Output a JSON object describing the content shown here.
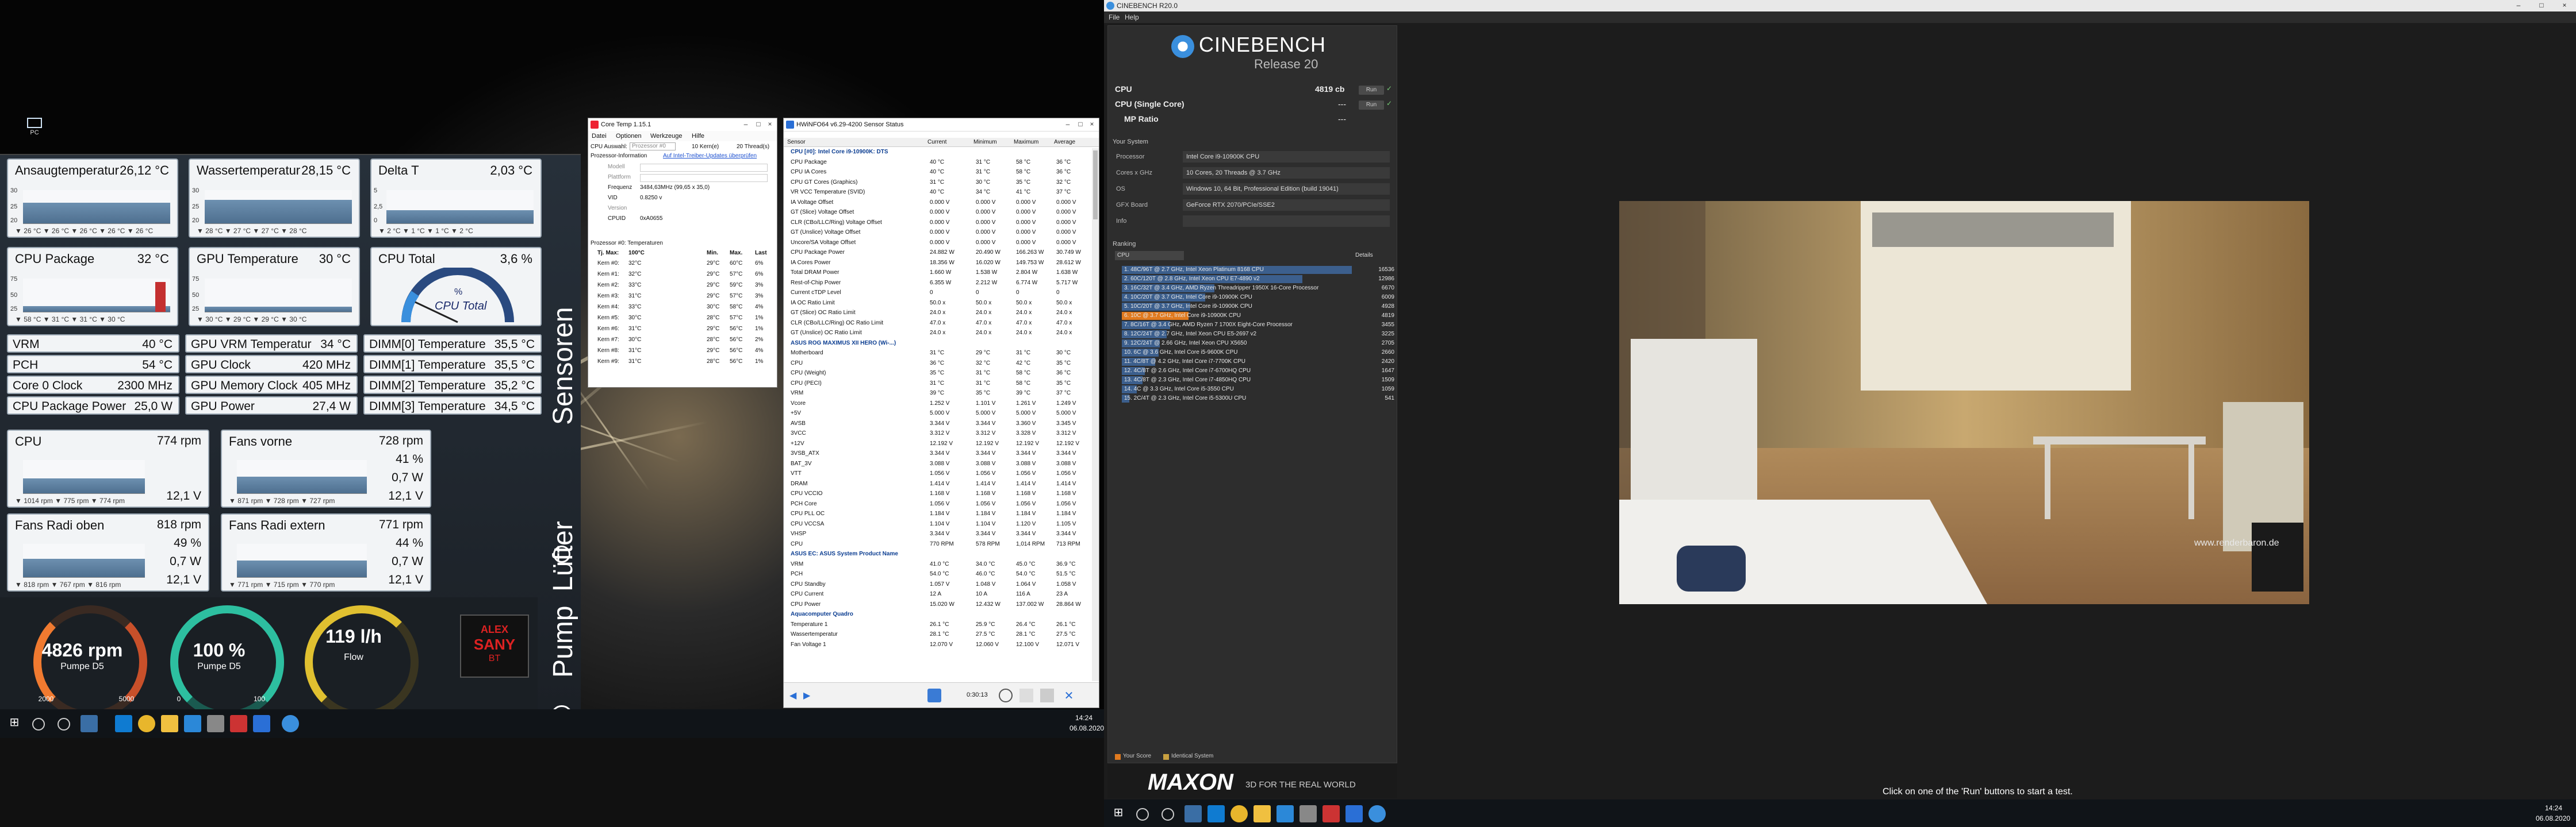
{
  "left": {
    "desktop": {
      "pc_icon_label": "PC"
    },
    "panel": {
      "temp_tiles": [
        {
          "label": "Ansaugtemperatur",
          "value": "26,12 °C",
          "ymax": "30",
          "ymid": "25",
          "ymin": "20",
          "ticks": "▼ 26 °C  ▼ 26 °C  ▼ 26 °C  ▼ 26 °C  ▼ 26 °C"
        },
        {
          "label": "Wassertemperatur",
          "value": "28,15 °C",
          "ymax": "30",
          "ymid": "25",
          "ymin": "20",
          "ticks": "▼ 28 °C  ▼ 27 °C  ▼ 27 °C  ▼ 28 °C"
        },
        {
          "label": "Delta T",
          "value": "2,03 °C",
          "ymax": "5",
          "ymid": "2,5",
          "ymin": "0",
          "ticks": "▼ 2 °C  ▼ 1 °C  ▼ 1 °C  ▼ 2 °C"
        },
        {
          "label": "CPU Package",
          "value": "32 °C",
          "ymax": "75",
          "ymid": "50",
          "ymin": "25",
          "ticks": "▼ 58 °C  ▼ 31 °C  ▼ 31 °C  ▼ 30 °C"
        },
        {
          "label": "GPU Temperature",
          "value": "30 °C",
          "ymax": "75",
          "ymid": "50",
          "ymin": "25",
          "ticks": "▼ 30 °C  ▼ 29 °C  ▼ 29 °C  ▼ 30 °C"
        }
      ],
      "cpu_total": {
        "label": "CPU Total",
        "value": "3,6 %",
        "gauge_label": "CPU Total",
        "gauge_unit": "%"
      },
      "rows": [
        [
          {
            "label": "VRM",
            "value": "40 °C"
          },
          {
            "label": "GPU VRM Temperatur",
            "value": "34 °C"
          },
          {
            "label": "DIMM[0] Temperature",
            "value": "35,5 °C"
          }
        ],
        [
          {
            "label": "PCH",
            "value": "54 °C"
          },
          {
            "label": "GPU Clock",
            "value": "420 MHz"
          },
          {
            "label": "DIMM[1] Temperature",
            "value": "35,5 °C"
          }
        ],
        [
          {
            "label": "Core 0 Clock",
            "value": "2300 MHz"
          },
          {
            "label": "GPU Memory Clock",
            "value": "405 MHz"
          },
          {
            "label": "DIMM[2] Temperature",
            "value": "35,2 °C"
          }
        ],
        [
          {
            "label": "CPU Package Power",
            "value": "25,0 W"
          },
          {
            "label": "GPU Power",
            "value": "27,4 W"
          },
          {
            "label": "DIMM[3] Temperature",
            "value": "34,5 °C"
          }
        ]
      ],
      "fan_tiles": [
        {
          "label": "CPU",
          "rpm": "774 rpm",
          "pct": "",
          "volt": "12,1 V",
          "ticks": "▼ 1014 rpm  ▼ 775 rpm  ▼ 774 rpm"
        },
        {
          "label": "Fans vorne",
          "rpm": "728 rpm",
          "pct": "41 %",
          "volt": "0,7 W",
          "volt2": "12,1 V",
          "ticks": "▼ 871 rpm  ▼ 728 rpm  ▼ 727 rpm"
        },
        {
          "label": "Fans Radi oben",
          "rpm": "818 rpm",
          "pct": "49 %",
          "volt": "0,7 W",
          "volt2": "12,1 V",
          "ticks": "▼ 818 rpm  ▼ 767 rpm  ▼ 816 rpm"
        },
        {
          "label": "Fans Radi extern",
          "rpm": "771 rpm",
          "pct": "44 %",
          "volt": "0,7 W",
          "volt2": "12,1 V",
          "ticks": "▼ 771 rpm  ▼ 715 rpm  ▼ 770 rpm"
        }
      ],
      "pump": {
        "rpm_value": "4826 rpm",
        "rpm_label": "Pumpe D5",
        "rpm_min": "2000",
        "rpm_max": "5000",
        "pct_value": "100 %",
        "pct_label": "Pumpe D5",
        "pct_min": "0",
        "pct_max": "100",
        "flow_value": "119 l/h",
        "flow_label": "Flow",
        "logo_line1": "ALEX",
        "logo_line2": "SANY",
        "logo_line3": "BT"
      },
      "side_labels": {
        "sensoren": "Sensoren",
        "luefter": "Lüfter",
        "pump": "Pump"
      }
    },
    "coretemp": {
      "title": "Core Temp 1.15.1",
      "menu": [
        "Datei",
        "Optionen",
        "Werkzeuge",
        "Hilfe"
      ],
      "cpu_select_label": "CPU Auswahl:",
      "cpu_select_value": "Prozessor #0",
      "cores_label": "10 Kern(e)",
      "threads_label": "20 Thread(s)",
      "proc_info_label": "Prozessor-Information",
      "update_link": "Auf Intel-Treiber-Updates überprüfen",
      "fields": [
        {
          "label": "Modell",
          "value": ""
        },
        {
          "label": "Plattform",
          "value": ""
        },
        {
          "label": "Frequenz",
          "value": "3484,63MHz (99,65 x 35,0)"
        },
        {
          "label": "VID",
          "value": "0.8250 v"
        },
        {
          "label": "Version",
          "value": ""
        },
        {
          "label": "CPUID",
          "value": "0xA0655"
        }
      ],
      "temps_title": "Prozessor #0: Temperaturen",
      "temp_headers": [
        "Tj. Max:",
        "100°C",
        "Min.",
        "Max.",
        "Last"
      ],
      "cores": [
        [
          "Kern #0:",
          "32°C",
          "29°C",
          "60°C",
          "6%"
        ],
        [
          "Kern #1:",
          "32°C",
          "29°C",
          "57°C",
          "6%"
        ],
        [
          "Kern #2:",
          "33°C",
          "29°C",
          "59°C",
          "3%"
        ],
        [
          "Kern #3:",
          "31°C",
          "29°C",
          "57°C",
          "3%"
        ],
        [
          "Kern #4:",
          "33°C",
          "30°C",
          "58°C",
          "4%"
        ],
        [
          "Kern #5:",
          "30°C",
          "28°C",
          "57°C",
          "1%"
        ],
        [
          "Kern #6:",
          "31°C",
          "29°C",
          "56°C",
          "1%"
        ],
        [
          "Kern #7:",
          "30°C",
          "28°C",
          "56°C",
          "2%"
        ],
        [
          "Kern #8:",
          "31°C",
          "29°C",
          "56°C",
          "4%"
        ],
        [
          "Kern #9:",
          "31°C",
          "28°C",
          "56°C",
          "1%"
        ]
      ]
    },
    "hwinfo": {
      "title": "HWiNFO64 v6.29-4200 Sensor Status",
      "headers": [
        "Sensor",
        "Current",
        "Minimum",
        "Maximum",
        "Average"
      ],
      "rows": [
        {
          "g": true,
          "name": "CPU [#0]: Intel Core i9-10900K: DTS"
        },
        {
          "name": "CPU Package",
          "c": "40 °C",
          "mn": "31 °C",
          "mx": "58 °C",
          "av": "36 °C"
        },
        {
          "name": "CPU IA Cores",
          "c": "40 °C",
          "mn": "31 °C",
          "mx": "58 °C",
          "av": "36 °C"
        },
        {
          "name": "CPU GT Cores (Graphics)",
          "c": "31 °C",
          "mn": "30 °C",
          "mx": "35 °C",
          "av": "32 °C"
        },
        {
          "name": "VR VCC Temperature (SVID)",
          "c": "40 °C",
          "mn": "34 °C",
          "mx": "41 °C",
          "av": "37 °C"
        },
        {
          "name": "IA Voltage Offset",
          "c": "0.000 V",
          "mn": "0.000 V",
          "mx": "0.000 V",
          "av": "0.000 V"
        },
        {
          "name": "GT (Slice) Voltage Offset",
          "c": "0.000 V",
          "mn": "0.000 V",
          "mx": "0.000 V",
          "av": "0.000 V"
        },
        {
          "name": "CLR (CBo/LLC/Ring) Voltage Offset",
          "c": "0.000 V",
          "mn": "0.000 V",
          "mx": "0.000 V",
          "av": "0.000 V"
        },
        {
          "name": "GT (Unslice) Voltage Offset",
          "c": "0.000 V",
          "mn": "0.000 V",
          "mx": "0.000 V",
          "av": "0.000 V"
        },
        {
          "name": "Uncore/SA Voltage Offset",
          "c": "0.000 V",
          "mn": "0.000 V",
          "mx": "0.000 V",
          "av": "0.000 V"
        },
        {
          "name": "CPU Package Power",
          "c": "24.882 W",
          "mn": "20.490 W",
          "mx": "166.263 W",
          "av": "30.749 W"
        },
        {
          "name": "IA Cores Power",
          "c": "18.356 W",
          "mn": "16.020 W",
          "mx": "149.753 W",
          "av": "28.612 W"
        },
        {
          "name": "Total DRAM Power",
          "c": "1.660 W",
          "mn": "1.538 W",
          "mx": "2.804 W",
          "av": "1.638 W"
        },
        {
          "name": "Rest-of-Chip Power",
          "c": "6.355 W",
          "mn": "2.212 W",
          "mx": "6.774 W",
          "av": "5.717 W"
        },
        {
          "name": "Current cTDP Level",
          "c": "0",
          "mn": "0",
          "mx": "0",
          "av": "0"
        },
        {
          "name": "IA OC Ratio Limit",
          "c": "50.0 x",
          "mn": "50.0 x",
          "mx": "50.0 x",
          "av": "50.0 x"
        },
        {
          "name": "GT (Slice) OC Ratio Limit",
          "c": "24.0 x",
          "mn": "24.0 x",
          "mx": "24.0 x",
          "av": "24.0 x"
        },
        {
          "name": "CLR (CBo/LLC/Ring) OC Ratio Limit",
          "c": "47.0 x",
          "mn": "47.0 x",
          "mx": "47.0 x",
          "av": "47.0 x"
        },
        {
          "name": "GT (Unslice) OC Ratio Limit",
          "c": "24.0 x",
          "mn": "24.0 x",
          "mx": "24.0 x",
          "av": "24.0 x"
        },
        {
          "g": true,
          "name": "ASUS ROG MAXIMUS XII HERO (Wi-...)"
        },
        {
          "name": "Motherboard",
          "c": "31 °C",
          "mn": "29 °C",
          "mx": "31 °C",
          "av": "30 °C"
        },
        {
          "name": "CPU",
          "c": "36 °C",
          "mn": "32 °C",
          "mx": "42 °C",
          "av": "35 °C"
        },
        {
          "name": "CPU (Weight)",
          "c": "35 °C",
          "mn": "31 °C",
          "mx": "58 °C",
          "av": "36 °C"
        },
        {
          "name": "CPU (PECI)",
          "c": "31 °C",
          "mn": "31 °C",
          "mx": "58 °C",
          "av": "35 °C"
        },
        {
          "name": "VRM",
          "c": "39 °C",
          "mn": "35 °C",
          "mx": "39 °C",
          "av": "37 °C"
        },
        {
          "name": "Vcore",
          "c": "1.252 V",
          "mn": "1.101 V",
          "mx": "1.261 V",
          "av": "1.249 V"
        },
        {
          "name": "+5V",
          "c": "5.000 V",
          "mn": "5.000 V",
          "mx": "5.000 V",
          "av": "5.000 V"
        },
        {
          "name": "AVSB",
          "c": "3.344 V",
          "mn": "3.344 V",
          "mx": "3.360 V",
          "av": "3.345 V"
        },
        {
          "name": "3VCC",
          "c": "3.312 V",
          "mn": "3.312 V",
          "mx": "3.328 V",
          "av": "3.312 V"
        },
        {
          "name": "+12V",
          "c": "12.192 V",
          "mn": "12.192 V",
          "mx": "12.192 V",
          "av": "12.192 V"
        },
        {
          "name": "3VSB_ATX",
          "c": "3.344 V",
          "mn": "3.344 V",
          "mx": "3.344 V",
          "av": "3.344 V"
        },
        {
          "name": "BAT_3V",
          "c": "3.088 V",
          "mn": "3.088 V",
          "mx": "3.088 V",
          "av": "3.088 V"
        },
        {
          "name": "VTT",
          "c": "1.056 V",
          "mn": "1.056 V",
          "mx": "1.056 V",
          "av": "1.056 V"
        },
        {
          "name": "DRAM",
          "c": "1.414 V",
          "mn": "1.414 V",
          "mx": "1.414 V",
          "av": "1.414 V"
        },
        {
          "name": "CPU VCCIO",
          "c": "1.168 V",
          "mn": "1.168 V",
          "mx": "1.168 V",
          "av": "1.168 V"
        },
        {
          "name": "PCH Core",
          "c": "1.056 V",
          "mn": "1.056 V",
          "mx": "1.056 V",
          "av": "1.056 V"
        },
        {
          "name": "CPU PLL OC",
          "c": "1.184 V",
          "mn": "1.184 V",
          "mx": "1.184 V",
          "av": "1.184 V"
        },
        {
          "name": "CPU VCCSA",
          "c": "1.104 V",
          "mn": "1.104 V",
          "mx": "1.120 V",
          "av": "1.105 V"
        },
        {
          "name": "VHSP",
          "c": "3.344 V",
          "mn": "3.344 V",
          "mx": "3.344 V",
          "av": "3.344 V"
        },
        {
          "name": "CPU",
          "c": "770 RPM",
          "mn": "578 RPM",
          "mx": "1,014 RPM",
          "av": "713 RPM"
        },
        {
          "g": true,
          "name": "ASUS EC: ASUS System Product Name"
        },
        {
          "name": "VRM",
          "c": "41.0 °C",
          "mn": "34.0 °C",
          "mx": "45.0 °C",
          "av": "36.9 °C"
        },
        {
          "name": "PCH",
          "c": "54.0 °C",
          "mn": "46.0 °C",
          "mx": "54.0 °C",
          "av": "51.5 °C"
        },
        {
          "name": "CPU Standby",
          "c": "1.057 V",
          "mn": "1.048 V",
          "mx": "1.064 V",
          "av": "1.058 V"
        },
        {
          "name": "CPU Current",
          "c": "12 A",
          "mn": "10 A",
          "mx": "116 A",
          "av": "23 A"
        },
        {
          "name": "CPU Power",
          "c": "15.020 W",
          "mn": "12.432 W",
          "mx": "137.002 W",
          "av": "28.864 W"
        },
        {
          "g": true,
          "name": "Aquacomputer Quadro"
        },
        {
          "name": "Temperature 1",
          "c": "26.1 °C",
          "mn": "25.9 °C",
          "mx": "26.4 °C",
          "av": "26.1 °C"
        },
        {
          "name": "Wassertemperatur",
          "c": "28.1 °C",
          "mn": "27.5 °C",
          "mx": "28.1 °C",
          "av": "27.5 °C"
        },
        {
          "name": "Fan Voltage 1",
          "c": "12.070 V",
          "mn": "12.060 V",
          "mx": "12.100 V",
          "av": "12.071 V"
        }
      ],
      "footer_time": "0:30:13"
    },
    "taskbar": {
      "time": "14:24",
      "date": "06.08.2020"
    }
  },
  "right": {
    "title": "CINEBENCH R20.0",
    "menu": [
      "File",
      "Help"
    ],
    "logo_text": "CINEBENCH",
    "logo_release": "Release 20",
    "cpu_label": "CPU",
    "cpu_score": "4819 cb",
    "cpu_single_label": "CPU (Single Core)",
    "cpu_single_score": "---",
    "mp_label": "MP Ratio",
    "mp_score": "---",
    "run_label": "Run",
    "system_title": "Your System",
    "system": [
      {
        "label": "Processor",
        "value": "Intel Core i9-10900K CPU"
      },
      {
        "label": "Cores x GHz",
        "value": "10 Cores, 20 Threads @ 3.7 GHz"
      },
      {
        "label": "OS",
        "value": "Windows 10, 64 Bit, Professional Edition (build 19041)"
      },
      {
        "label": "GFX Board",
        "value": "GeForce RTX 2070/PCIe/SSE2"
      },
      {
        "label": "Info",
        "value": ""
      }
    ],
    "ranking_title": "Ranking",
    "ranking_select": "CPU",
    "details_label": "Details",
    "ranking": [
      {
        "text": "1. 48C/96T @ 2.7 GHz, Intel Xeon Platinum 8168 CPU",
        "score": "16536",
        "pct": 1.0
      },
      {
        "text": "2. 60C/120T @ 2.8 GHz, Intel Xeon CPU E7-4890 v2",
        "score": "12986",
        "pct": 0.785
      },
      {
        "text": "3. 16C/32T @ 3.4 GHz, AMD Ryzen Threadripper 1950X 16-Core Processor",
        "score": "6670",
        "pct": 0.403
      },
      {
        "text": "4. 10C/20T @ 3.7 GHz, Intel Core i9-10900K CPU",
        "score": "6009",
        "pct": 0.363
      },
      {
        "text": "5. 10C/20T @ 3.7 GHz, Intel Core i9-10900K CPU",
        "score": "4928",
        "pct": 0.298
      },
      {
        "text": "6. 10C @ 3.7 GHz, Intel Core i9-10900K CPU",
        "score": "4819",
        "pct": 0.291,
        "me": true
      },
      {
        "text": "7. 8C/16T @ 3.4 GHz, AMD Ryzen 7 1700X Eight-Core Processor",
        "score": "3455",
        "pct": 0.209
      },
      {
        "text": "8. 12C/24T @ 2.7 GHz, Intel Xeon CPU E5-2697 v2",
        "score": "3225",
        "pct": 0.195
      },
      {
        "text": "9. 12C/24T @ 2.66 GHz, Intel Xeon CPU X5650",
        "score": "2705",
        "pct": 0.164
      },
      {
        "text": "10. 6C @ 3.6 GHz, Intel Core i5-9600K CPU",
        "score": "2660",
        "pct": 0.161
      },
      {
        "text": "11. 4C/8T @ 4.2 GHz, Intel Core i7-7700K CPU",
        "score": "2420",
        "pct": 0.146
      },
      {
        "text": "12. 4C/8T @ 2.6 GHz, Intel Core i7-6700HQ CPU",
        "score": "1647",
        "pct": 0.1
      },
      {
        "text": "13. 4C/8T @ 2.3 GHz, Intel Core i7-4850HQ CPU",
        "score": "1509",
        "pct": 0.091
      },
      {
        "text": "14. 4C @ 3.3 GHz, Intel Core i5-3550 CPU",
        "score": "1059",
        "pct": 0.064
      },
      {
        "text": "15. 2C/4T @ 2.3 GHz, Intel Core i5-5300U CPU",
        "score": "541",
        "pct": 0.033
      }
    ],
    "legend_your": "Your Score",
    "legend_identical": "Identical System",
    "maxon_logo": "MAXON",
    "maxon_tagline": "3D FOR THE REAL WORLD",
    "render_watermark": "www.renderbaron.de",
    "status_text": "Click on one of the 'Run' buttons to start a test.",
    "taskbar_time": "14:24",
    "taskbar_date": "06.08.2020",
    "colors": {
      "rank_bar": "#3c5f8d",
      "rank_me": "#e07a1f",
      "panel": "#2d2d2d"
    }
  }
}
